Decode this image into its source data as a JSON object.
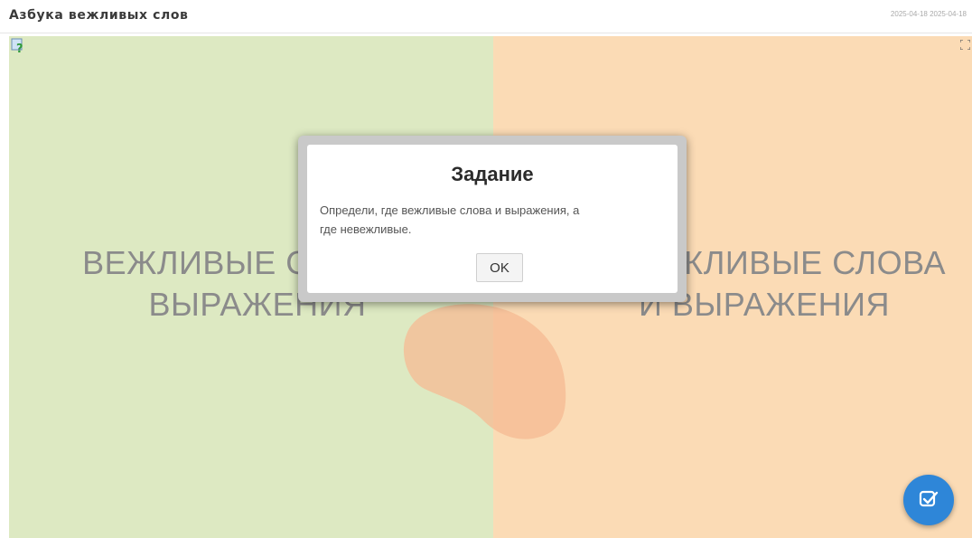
{
  "header": {
    "title": "Азбука вежливых слов",
    "date": "2025-04-18 2025-04-18"
  },
  "zones": {
    "left": {
      "line1": "ВЕЖЛИВЫЕ СЛОВА И",
      "line2": "ВЫРАЖЕНИЯ",
      "color": "#dde9c2"
    },
    "right": {
      "line1": "НЕВЕЖЛИВЫЕ СЛОВА",
      "line2": "И ВЫРАЖЕНИЯ",
      "color": "#fbdbb5"
    }
  },
  "dialog": {
    "title": "Задание",
    "text": "Определи, где вежливые слова и выражения, а где невежливые.",
    "ok_label": "OK"
  },
  "icons": {
    "help": "help-icon",
    "fullscreen": "fullscreen-icon",
    "check": "check-icon"
  },
  "colors": {
    "accent": "#2e86d8",
    "hand": "#f6b993"
  }
}
